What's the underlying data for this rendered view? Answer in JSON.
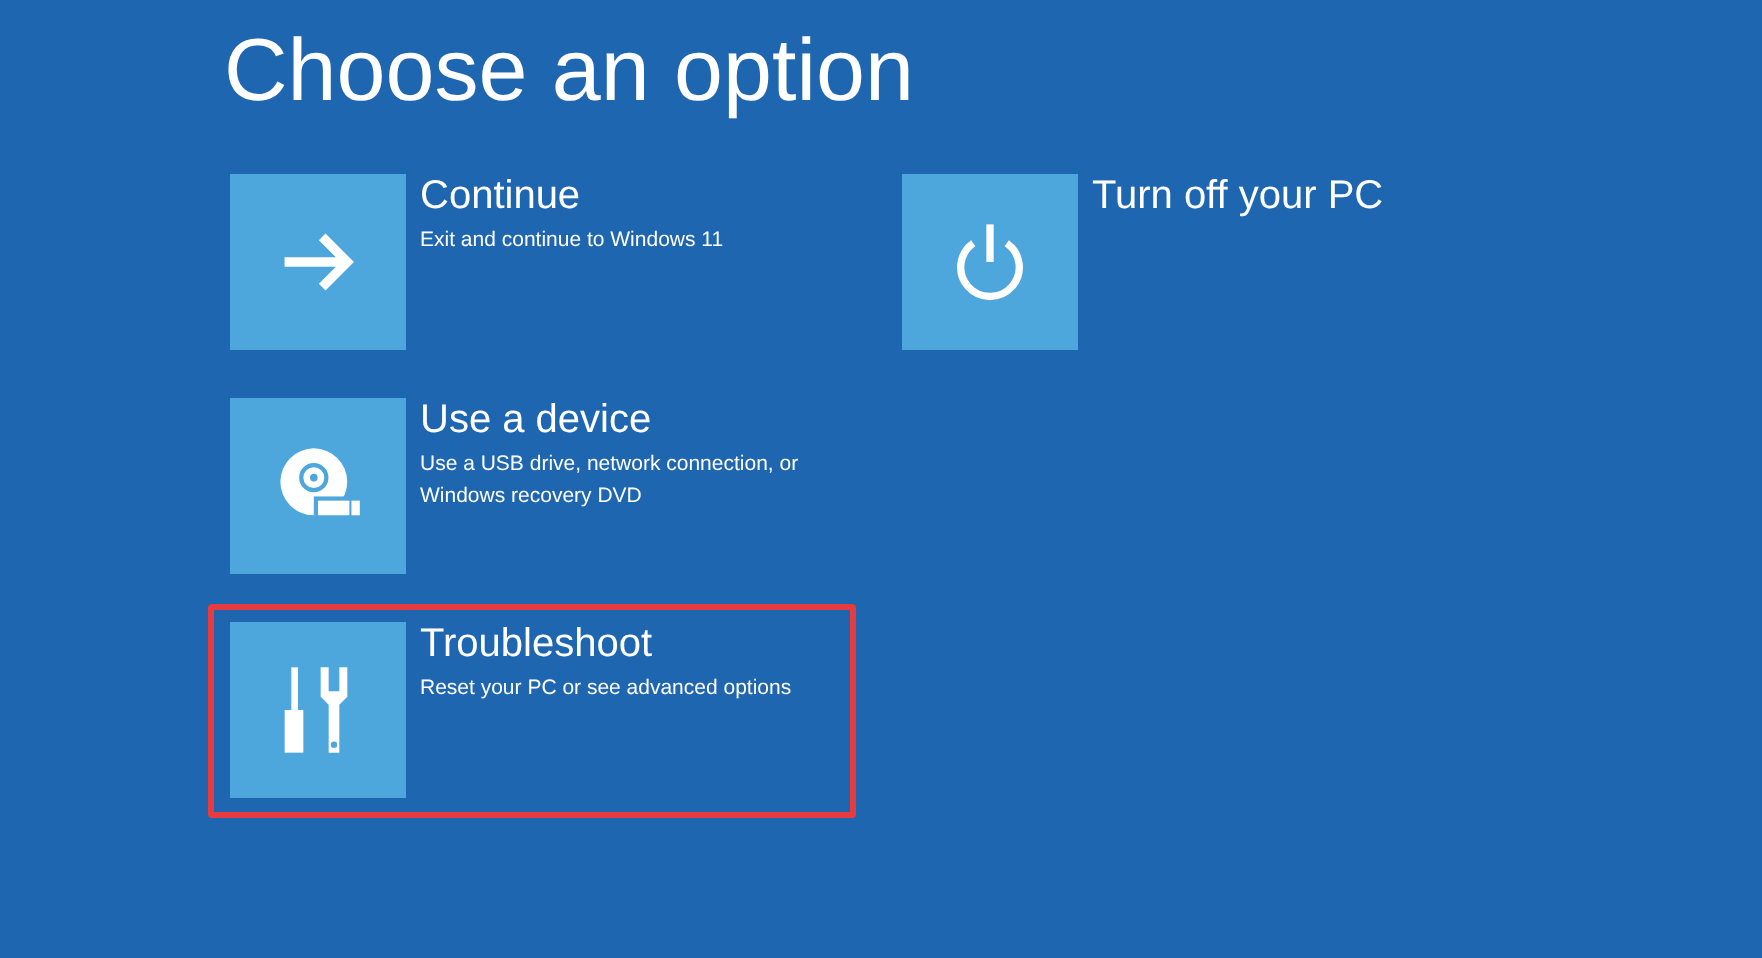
{
  "title": "Choose an option",
  "columns": [
    [
      {
        "kind": "arrow",
        "title": "Continue",
        "description": "Exit and continue to Windows 11",
        "highlighted": false
      },
      {
        "kind": "device",
        "title": "Use a device",
        "description": "Use a USB drive, network connection, or Windows recovery DVD",
        "highlighted": false
      },
      {
        "kind": "tools",
        "title": "Troubleshoot",
        "description": "Reset your PC or see advanced options",
        "highlighted": true
      }
    ],
    [
      {
        "kind": "power",
        "title": "Turn off your PC",
        "highlighted": false
      }
    ]
  ]
}
